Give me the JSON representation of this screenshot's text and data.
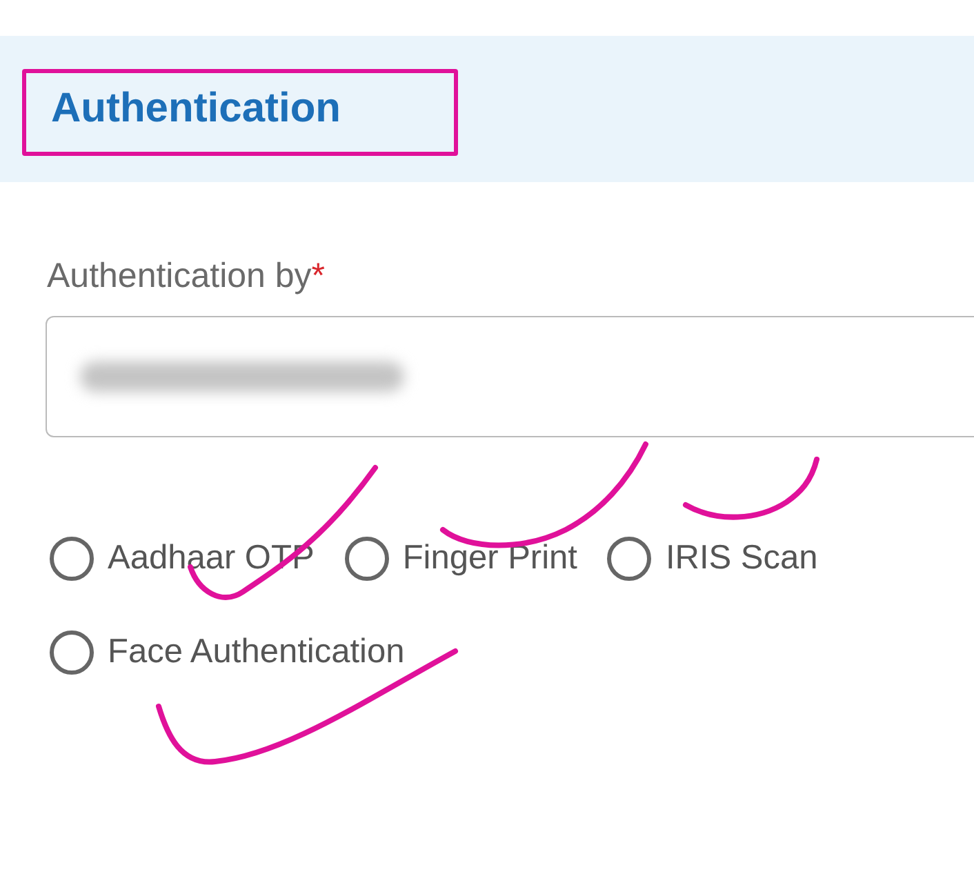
{
  "section": {
    "title": "Authentication",
    "highlighted": true
  },
  "field": {
    "label": "Authentication by",
    "required_mark": "*",
    "value_hidden": true
  },
  "options": [
    {
      "label": "Aadhaar OTP",
      "selected": false,
      "ticked": true
    },
    {
      "label": "Finger Print",
      "selected": false,
      "ticked": true
    },
    {
      "label": "IRIS Scan",
      "selected": false,
      "ticked": true
    },
    {
      "label": "Face Authentication",
      "selected": false,
      "ticked": true
    }
  ]
}
